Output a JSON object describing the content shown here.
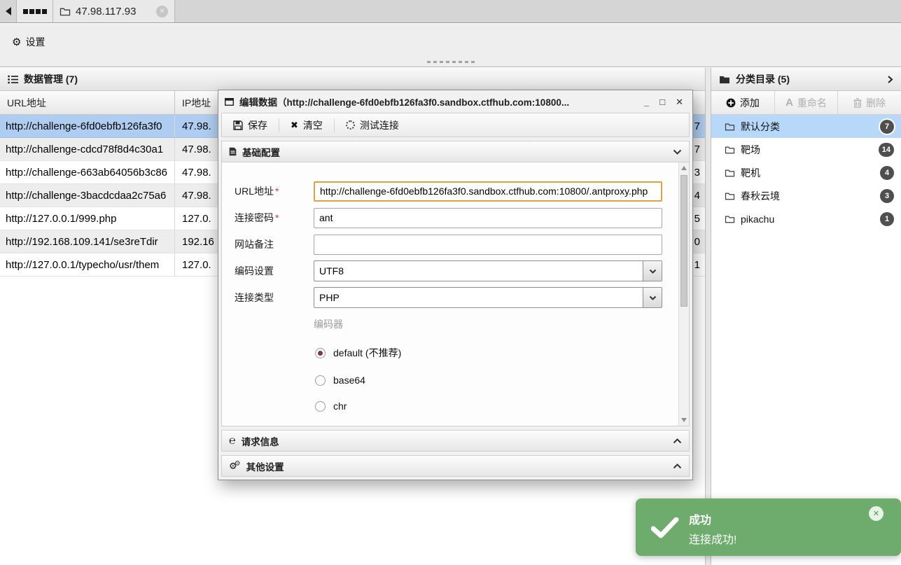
{
  "window": {
    "tabbar": {
      "ip_tab_label": "47.98.117.93"
    },
    "toolbar": {
      "settings_label": "设置"
    }
  },
  "data_panel": {
    "title": "数据管理 (7)",
    "columns": {
      "url": "URL地址",
      "ip": "IP地址"
    },
    "rows": [
      {
        "url": "http://challenge-6fd0ebfb126fa3f0",
        "ip": "47.98.",
        "num": "7"
      },
      {
        "url": "http://challenge-cdcd78f8d4c30a1",
        "ip": "47.98.",
        "num": "7"
      },
      {
        "url": "http://challenge-663ab64056b3c86",
        "ip": "47.98.",
        "num": "3"
      },
      {
        "url": "http://challenge-3bacdcdaa2c75a6",
        "ip": "47.98.",
        "num": "4"
      },
      {
        "url": "http://127.0.0.1/999.php",
        "ip": "127.0.",
        "num": "5"
      },
      {
        "url": "http://192.168.109.141/se3reTdir",
        "ip": "192.16",
        "num": "0"
      },
      {
        "url": "http://127.0.0.1/typecho/usr/them",
        "ip": "127.0.",
        "num": "1"
      }
    ]
  },
  "category_panel": {
    "title": "分类目录 (5)",
    "actions": {
      "add": "添加",
      "rename": "重命名",
      "delete": "删除"
    },
    "items": [
      {
        "name": "默认分类",
        "count": "7"
      },
      {
        "name": "靶场",
        "count": "14"
      },
      {
        "name": "靶机",
        "count": "4"
      },
      {
        "name": "春秋云境",
        "count": "3"
      },
      {
        "name": "pikachu",
        "count": "1"
      }
    ]
  },
  "dialog": {
    "title": "编辑数据（http://challenge-6fd0ebfb126fa3f0.sandbox.ctfhub.com:10800...",
    "controls": {
      "minimize": "_",
      "maximize": "□",
      "close": "✕"
    },
    "toolbar": {
      "save": "保存",
      "clear": "清空",
      "test": "测试连接"
    },
    "sections": {
      "basic": "基础配置",
      "request": "请求信息",
      "other": "其他设置"
    },
    "form": {
      "url": {
        "label": "URL地址",
        "required": "*",
        "value": "http://challenge-6fd0ebfb126fa3f0.sandbox.ctfhub.com:10800/.antproxy.php"
      },
      "password": {
        "label": "连接密码",
        "required": "*",
        "value": "ant"
      },
      "note": {
        "label": "网站备注",
        "value": ""
      },
      "encoding": {
        "label": "编码设置",
        "value": "UTF8"
      },
      "conn_type": {
        "label": "连接类型",
        "value": "PHP"
      },
      "encoder": {
        "label": "编码器",
        "options": [
          "default (不推荐)",
          "base64",
          "chr"
        ],
        "selected_index": 0
      }
    }
  },
  "toast": {
    "title": "成功",
    "message": "连接成功!"
  },
  "colors": {
    "selection_blue": "#aecdf0",
    "category_blue": "#b7d8f8",
    "toast_green": "#6dac6d",
    "focus_orange": "#dca43f"
  }
}
